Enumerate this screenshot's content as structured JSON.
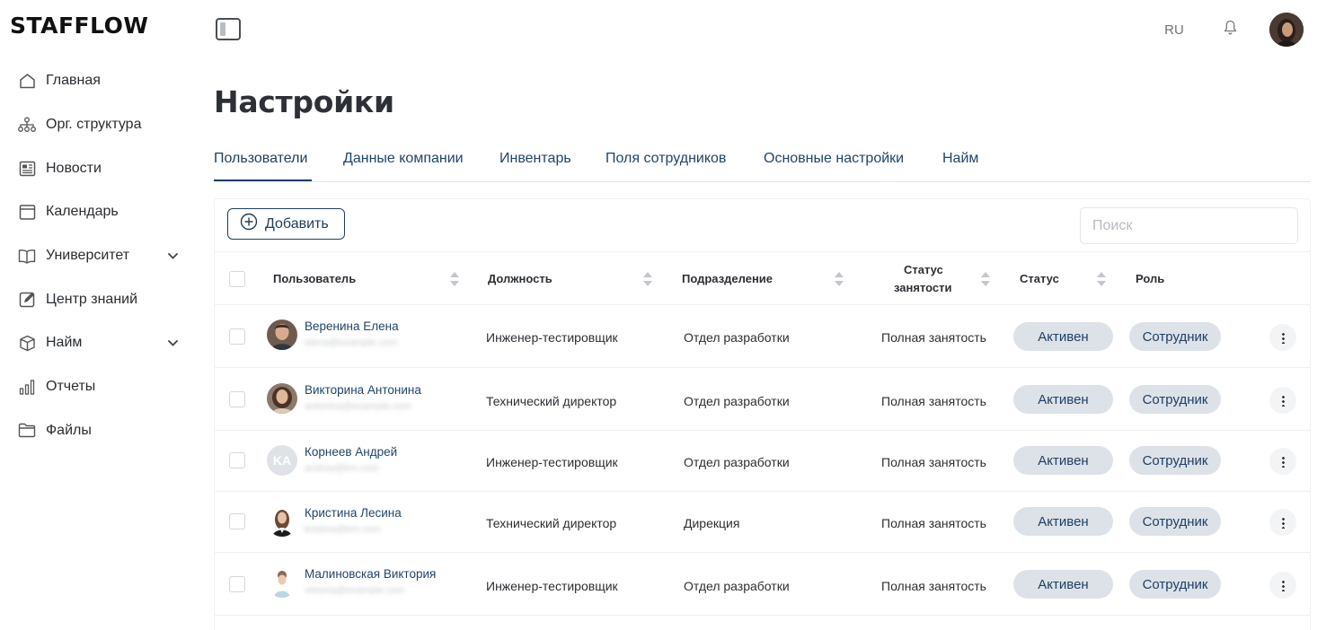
{
  "app": {
    "logo": "STAFFLOW"
  },
  "sidebar": {
    "items": [
      {
        "label": "Главная",
        "icon": "home-icon"
      },
      {
        "label": "Орг. структура",
        "icon": "org-structure-icon"
      },
      {
        "label": "Новости",
        "icon": "news-icon"
      },
      {
        "label": "Календарь",
        "icon": "calendar-icon"
      },
      {
        "label": "Университет",
        "icon": "book-icon",
        "expandable": true
      },
      {
        "label": "Центр знаний",
        "icon": "edit-icon"
      },
      {
        "label": "Найм",
        "icon": "box-icon",
        "expandable": true
      },
      {
        "label": "Отчеты",
        "icon": "bar-chart-icon"
      },
      {
        "label": "Файлы",
        "icon": "folder-icon"
      }
    ]
  },
  "topbar": {
    "language": "RU",
    "bell_icon": "bell-icon",
    "toggle_icon": "sidebar-toggle-icon"
  },
  "page": {
    "title": "Настройки"
  },
  "tabs": [
    {
      "label": "Пользователи",
      "active": true
    },
    {
      "label": "Данные компании"
    },
    {
      "label": "Инвентарь"
    },
    {
      "label": "Поля сотрудников"
    },
    {
      "label": "Основные настройки"
    },
    {
      "label": "Найм"
    }
  ],
  "toolbar": {
    "add_label": "Добавить",
    "search_placeholder": "Поиск"
  },
  "table": {
    "headers": {
      "user": "Пользователь",
      "position": "Должность",
      "department": "Подразделение",
      "employment_line1": "Статус",
      "employment_line2": "занятости",
      "status": "Статус",
      "role": "Роль"
    },
    "rows": [
      {
        "name": "Веренина Елена",
        "email": "elena@example.com",
        "position": "Инженер-тестировщик",
        "department": "Отдел разработки",
        "employment": "Полная занятость",
        "status": "Активен",
        "role": "Сотрудник",
        "avatar": "photo-man"
      },
      {
        "name": "Викторина Антонина",
        "email": "antonina@example.com",
        "position": "Технический директор",
        "department": "Отдел разработки",
        "employment": "Полная занятость",
        "status": "Активен",
        "role": "Сотрудник",
        "avatar": "photo-woman"
      },
      {
        "name": "Корнеев Андрей",
        "email": "andrey@km.com",
        "position": "Инженер-тестировщик",
        "department": "Отдел разработки",
        "employment": "Полная занятость",
        "status": "Активен",
        "role": "Сотрудник",
        "avatar": "initials",
        "initials": "KA"
      },
      {
        "name": "Кристина Лесина",
        "email": "kristina@km.com",
        "position": "Технический директор",
        "department": "Дирекция",
        "employment": "Полная занятость",
        "status": "Активен",
        "role": "Сотрудник",
        "avatar": "photo-woman-dark"
      },
      {
        "name": "Малиновская Виктория",
        "email": "viktoria@example.com",
        "position": "Инженер-тестировщик",
        "department": "Отдел разработки",
        "employment": "Полная занятость",
        "status": "Активен",
        "role": "Сотрудник",
        "avatar": "photo-woman-light"
      }
    ]
  },
  "colors": {
    "accent": "#1f3e60",
    "link": "#21456c",
    "pill": "#dde2e9",
    "border": "#eef0f2"
  }
}
